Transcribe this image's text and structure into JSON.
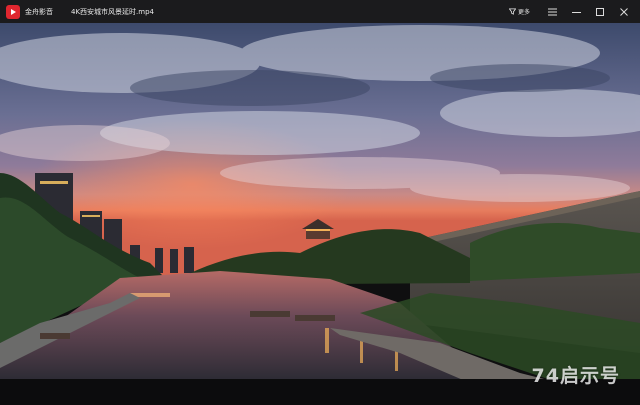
{
  "window": {
    "app_name": "金舟影音",
    "file_name": "4K西安城市风景延时.mp4",
    "more_label": "更多"
  },
  "icons": {
    "logo": "play-logo-icon",
    "more": "filter-icon",
    "menu": "hamburger-menu-icon",
    "minimize": "minimize-icon",
    "maximize": "maximize-icon",
    "close": "close-icon"
  },
  "colors": {
    "accent": "#e0262f",
    "titlebar": "#1b1b1d"
  },
  "overlay": {
    "watermark": "74启示号"
  }
}
